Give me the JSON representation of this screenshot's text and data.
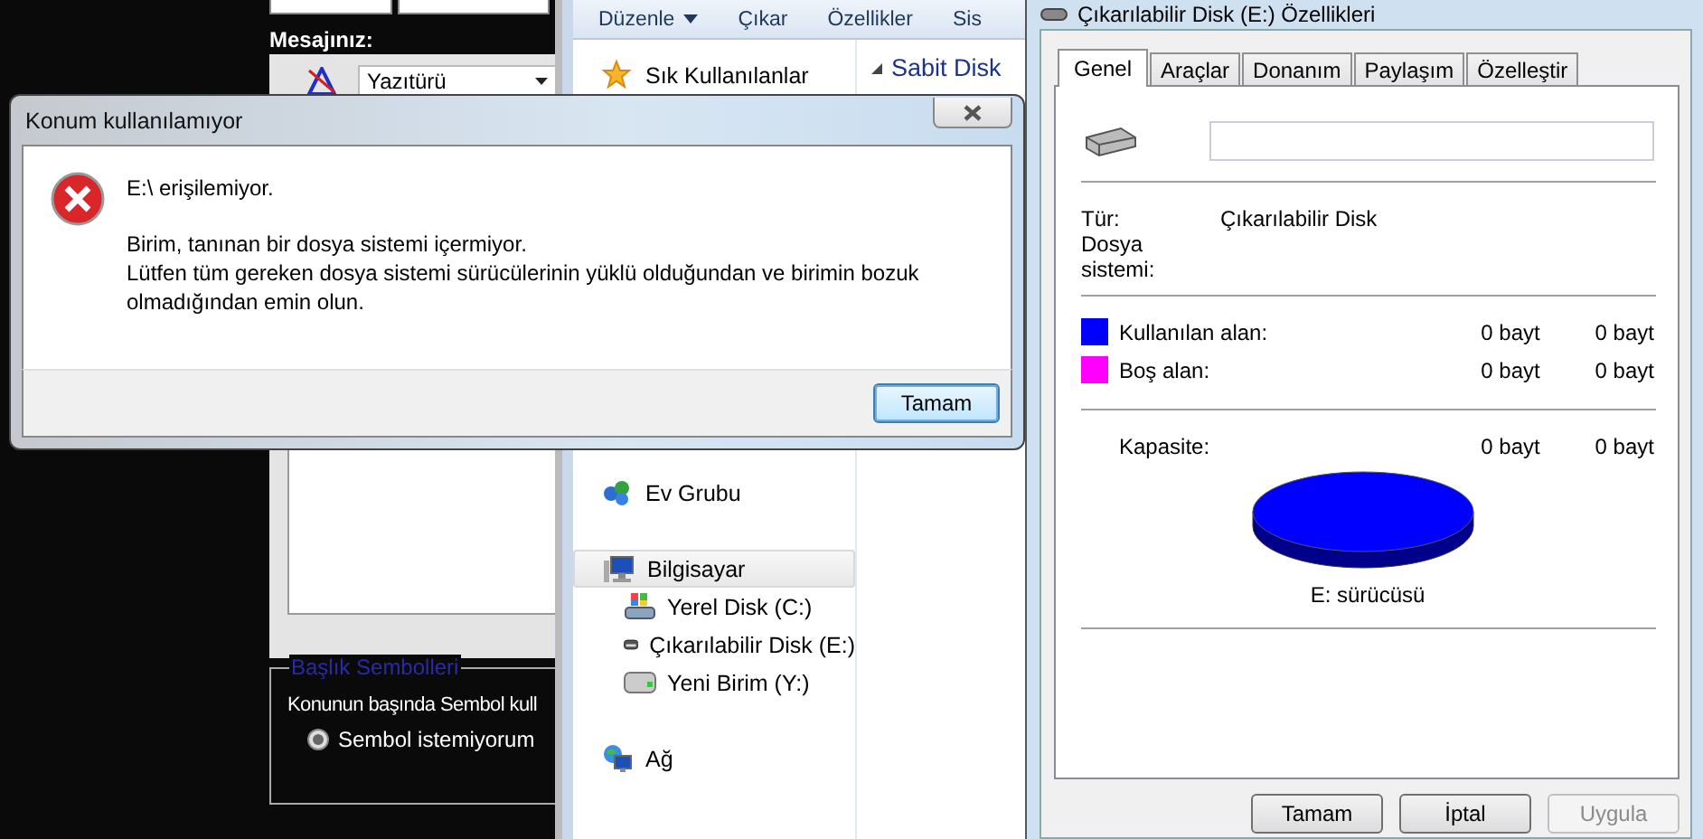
{
  "background_app": {
    "label": "Mesajınız:",
    "font_dropdown": "Yazıtürü",
    "group": {
      "title": "Başlık Sembolleri",
      "prompt": "Konunun başında Sembol kull",
      "options": [
        {
          "label": "Sembol istemiyorum",
          "selected": true
        }
      ]
    }
  },
  "explorer": {
    "toolbar": [
      {
        "label": "Düzenle",
        "dropdown": true
      },
      {
        "label": "Çıkar",
        "dropdown": false
      },
      {
        "label": "Özellikler",
        "dropdown": false
      },
      {
        "label": "Sis",
        "dropdown": false
      }
    ],
    "nav": [
      {
        "label": "Sık Kullanılanlar",
        "kind": "favorites",
        "selected": false
      },
      {
        "label": "Ev Grubu",
        "kind": "homegroup",
        "selected": false
      },
      {
        "label": "Bilgisayar",
        "kind": "computer",
        "selected": true,
        "children": [
          {
            "label": "Yerel Disk (C:)",
            "kind": "system-disk",
            "selected": false
          },
          {
            "label": "Çıkarılabilir Disk (E:)",
            "kind": "removable-disk",
            "selected": false
          },
          {
            "label": "Yeni Birim (Y:)",
            "kind": "disk",
            "selected": false
          }
        ]
      },
      {
        "label": "Ağ",
        "kind": "network",
        "selected": false
      }
    ],
    "heading": "Sabit Disk"
  },
  "error_dialog": {
    "title": "Konum kullanılamıyor",
    "heading": "E:\\ erişilemiyor.",
    "paragraphs": [
      "Birim, tanınan bir dosya sistemi içermiyor.",
      "Lütfen tüm gereken dosya sistemi sürücülerinin yüklü olduğundan ve birimin bozuk olmadığından emin olun."
    ],
    "button": {
      "label": "Tamam",
      "default": true
    }
  },
  "properties": {
    "title": "Çıkarılabilir Disk (E:) Özellikleri",
    "tabs": [
      {
        "label": "Genel",
        "selected": true
      },
      {
        "label": "Araçlar",
        "selected": false
      },
      {
        "label": "Donanım",
        "selected": false
      },
      {
        "label": "Paylaşım",
        "selected": false
      },
      {
        "label": "Özelleştir",
        "selected": false
      }
    ],
    "type": {
      "label": "Tür:",
      "value": "Çıkarılabilir Disk"
    },
    "file_system": {
      "label": "Dosya sistemi:"
    },
    "space": [
      {
        "label": "Kullanılan alan:",
        "color": "#0000ff",
        "bytes": "0 bayt",
        "size": "0 bayt"
      },
      {
        "label": "Boş alan:",
        "color": "#ff00ff",
        "bytes": "0 bayt",
        "size": "0 bayt"
      }
    ],
    "capacity": {
      "label": "Kapasite:",
      "bytes": "0 bayt",
      "size": "0 bayt"
    },
    "drive_label": "E: sürücüsü",
    "buttons": [
      {
        "label": "Tamam",
        "disabled": false
      },
      {
        "label": "İptal",
        "disabled": false
      },
      {
        "label": "Uygula",
        "disabled": true
      }
    ]
  }
}
